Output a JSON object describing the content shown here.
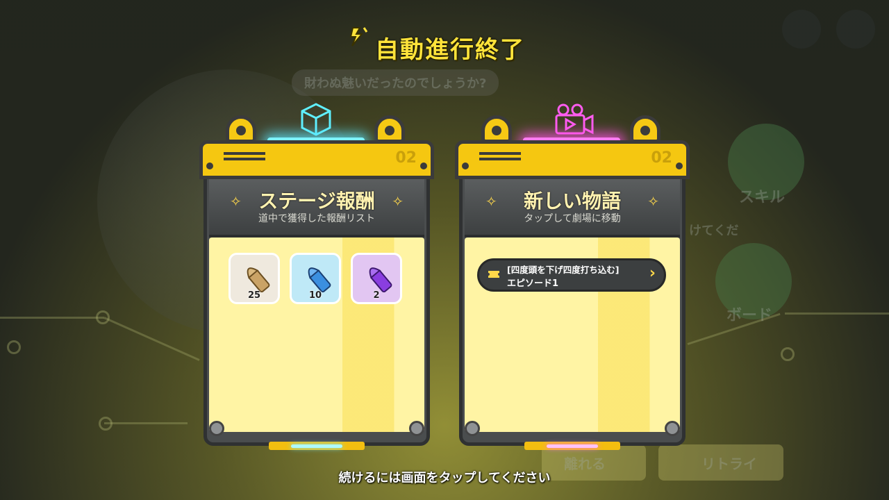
{
  "title": "自動進行終了",
  "background": {
    "question_text": "財わぬ魅いだったのでしょうか?",
    "skill_label": "スキル",
    "board_label": "ボード",
    "partial_text": "けてくだ",
    "button_left": "離れる",
    "button_right": "リトライ"
  },
  "left_panel": {
    "number": "02",
    "title": "ステージ報酬",
    "subtitle": "道中で獲得した報酬リスト",
    "items": [
      {
        "name": "bullet-bronze",
        "count": "25",
        "color": "#c9a36b"
      },
      {
        "name": "bullet-blue",
        "count": "10",
        "color": "#3b8fe0"
      },
      {
        "name": "bullet-purple",
        "count": "2",
        "color": "#8a3ee0"
      }
    ]
  },
  "right_panel": {
    "number": "02",
    "title": "新しい物語",
    "subtitle": "タップして劇場に移動",
    "story": {
      "line1": "[四度頭を下げ四度打ち込む]",
      "line2": "エピソード1"
    }
  },
  "footer": "続けるには画面をタップしてください",
  "colors": {
    "accent_yellow": "#f5c711",
    "cyan_glow": "#7ef3ff",
    "pink_glow": "#ff7cf2"
  }
}
